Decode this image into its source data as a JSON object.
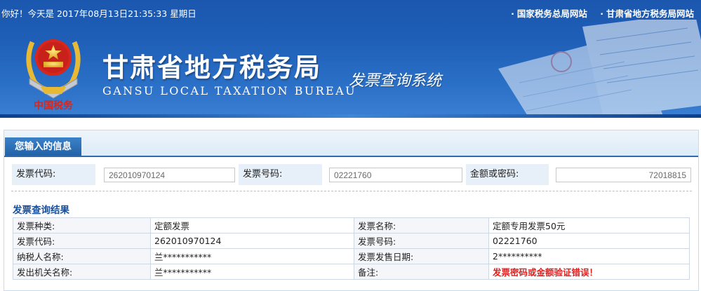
{
  "header": {
    "greeting": "你好！今天是 2017年08月13日21:35:33 星期日",
    "links": [
      {
        "dot": "·",
        "label": "国家税务总局网站"
      },
      {
        "dot": "·",
        "label": "甘肃省地方税务局网站"
      }
    ],
    "title_cn": "甘肃省地方税务局",
    "title_en": "GANSU LOCAL TAXATION BUREAU",
    "subtitle": "发票查询系统",
    "emblem_text": "中国税务",
    "emblem_icon": "tax-emblem-icon"
  },
  "input_panel": {
    "tab_label": "您输入的信息",
    "fields": [
      {
        "label": "发票代码:",
        "value": "262010970124"
      },
      {
        "label": "发票号码:",
        "value": "02221760"
      },
      {
        "label": "金额或密码:",
        "value": "72018815"
      }
    ]
  },
  "result": {
    "title": "发票查询结果",
    "rows": [
      [
        "发票种类:",
        "定额发票",
        "发票名称:",
        "定额专用发票50元"
      ],
      [
        "发票代码:",
        "262010970124",
        "发票号码:",
        "02221760"
      ],
      [
        "纳税人名称:",
        "兰***********",
        "发票发售日期:",
        "2**********"
      ],
      [
        "发出机关名称:",
        "兰***********",
        "备注:",
        "发票密码或金额验证错误！"
      ]
    ]
  },
  "colors": {
    "header_blue": "#1f5fb8",
    "tab_blue": "#2261a8",
    "result_title": "#1a4f9a",
    "error_red": "#e01f1f"
  }
}
